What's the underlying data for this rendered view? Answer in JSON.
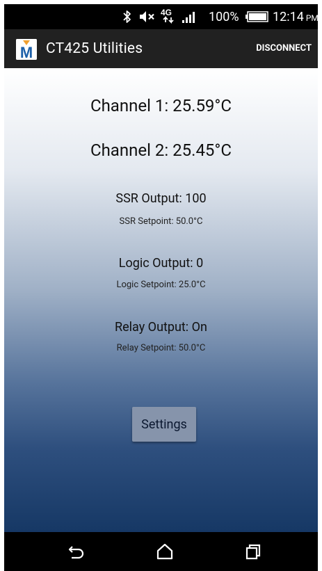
{
  "status_bar": {
    "network": "4G",
    "battery": "100%",
    "time": "12:14",
    "ampm": "PM"
  },
  "app_bar": {
    "logo_letter": "M",
    "title": "CT425 Utilities",
    "action": "DISCONNECT"
  },
  "readings": {
    "channel1": "Channel 1: 25.59°C",
    "channel2": "Channel 2: 25.45°C",
    "ssr_output": "SSR Output: 100",
    "ssr_setpoint": "SSR Setpoint: 50.0°C",
    "logic_output": "Logic Output: 0",
    "logic_setpoint": "Logic Setpoint: 25.0°C",
    "relay_output": "Relay Output: On",
    "relay_setpoint": "Relay Setpoint: 50.0°C"
  },
  "settings_label": "Settings",
  "colors": {
    "app_bar": "#212121",
    "logo_orange": "#f0a030",
    "logo_blue": "#1c5fa8",
    "button": "#8694ab"
  },
  "icons": {
    "status": [
      "bluetooth-icon",
      "mute-icon",
      "lte-data-icon",
      "signal-icon",
      "battery-icon"
    ],
    "nav": [
      "back-icon",
      "home-icon",
      "recents-icon"
    ]
  }
}
